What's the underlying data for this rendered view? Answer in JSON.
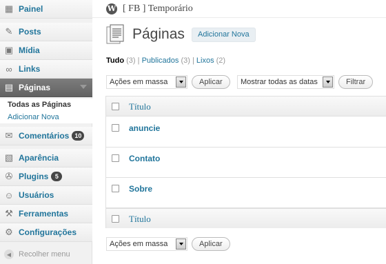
{
  "sidebar": {
    "items": [
      {
        "label": "Painel",
        "icon": "dashboard-icon"
      },
      {
        "label": "Posts",
        "icon": "pin-icon"
      },
      {
        "label": "Mídia",
        "icon": "media-icon"
      },
      {
        "label": "Links",
        "icon": "link-icon"
      },
      {
        "label": "Páginas",
        "icon": "pages-icon"
      },
      {
        "label": "Comentários",
        "icon": "comments-icon",
        "badge": "10"
      },
      {
        "label": "Aparência",
        "icon": "appearance-icon"
      },
      {
        "label": "Plugins",
        "icon": "plugins-icon",
        "badge": "5"
      },
      {
        "label": "Usuários",
        "icon": "users-icon"
      },
      {
        "label": "Ferramentas",
        "icon": "tools-icon"
      },
      {
        "label": "Configurações",
        "icon": "settings-icon"
      }
    ],
    "submenu": [
      "Todas as Páginas",
      "Adicionar Nova"
    ],
    "collapse": "Recolher menu"
  },
  "header": {
    "site_title": "[ FB ] Temporário"
  },
  "main": {
    "title": "Páginas",
    "add_new": "Adicionar Nova",
    "filters": {
      "all": "Tudo",
      "all_count": "(3)",
      "published": "Publicados",
      "published_count": "(3)",
      "trash": "Lixos",
      "trash_count": "(2)"
    },
    "bulk_actions": "Ações em massa",
    "apply": "Aplicar",
    "dates": "Mostrar todas as datas",
    "filter": "Filtrar",
    "column_title": "Título",
    "rows": [
      "anuncie",
      "Contato",
      "Sobre"
    ]
  },
  "colors": {
    "accent": "#21759b",
    "active_menu": "#6d6d6d"
  }
}
